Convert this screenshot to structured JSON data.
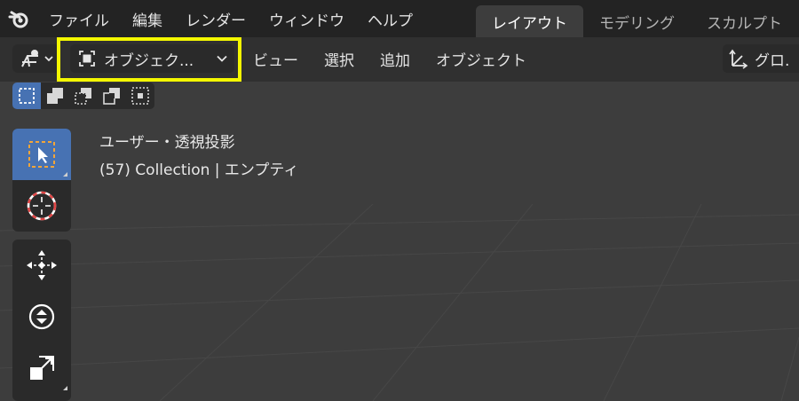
{
  "menubar": {
    "items": [
      "ファイル",
      "編集",
      "レンダー",
      "ウィンドウ",
      "ヘルプ"
    ]
  },
  "workspaces": {
    "tabs": [
      "レイアウト",
      "モデリング",
      "スカルプト"
    ],
    "active_index": 0
  },
  "header": {
    "mode_label": "オブジェク...",
    "menus": [
      "ビュー",
      "選択",
      "追加",
      "オブジェクト"
    ],
    "orientation_label": "グロ."
  },
  "selection_modes": {
    "icons": [
      "select-set-new-icon",
      "select-extend-icon",
      "select-subtract-icon",
      "select-invert-icon",
      "select-intersect-icon"
    ],
    "active_index": 0
  },
  "viewport": {
    "view_name": "ユーザー・透視投影",
    "collection_info": "(57) Collection | エンプティ"
  },
  "toolbar": {
    "icons": [
      "select-box-icon",
      "cursor-icon",
      "move-icon",
      "rotate-icon",
      "scale-icon"
    ],
    "active": "select-box-icon"
  },
  "colors": {
    "topbar": "#232323",
    "header": "#303030",
    "viewport": "#3d3d3d",
    "accent": "#4772b3",
    "highlight": "#f4f700"
  }
}
